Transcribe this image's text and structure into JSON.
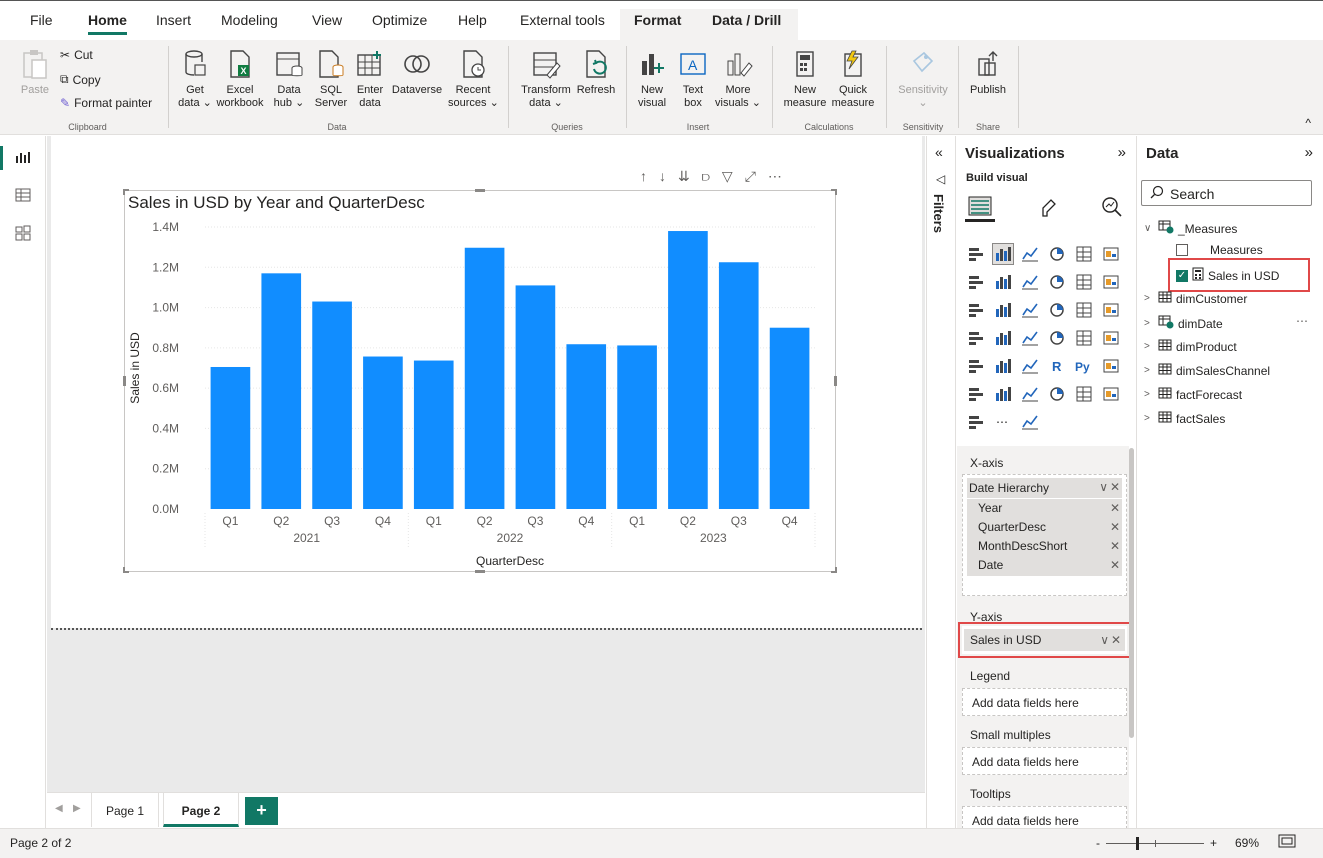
{
  "menu": {
    "tabs": [
      "File",
      "Home",
      "Insert",
      "Modeling",
      "View",
      "Optimize",
      "Help",
      "External tools",
      "Format",
      "Data / Drill"
    ],
    "active": "Home"
  },
  "ribbon": {
    "clipboard": {
      "paste": "Paste",
      "cut": "Cut",
      "copy": "Copy",
      "format_painter": "Format painter",
      "label": "Clipboard"
    },
    "data": {
      "get_data": [
        "Get",
        "data ⌄"
      ],
      "excel": [
        "Excel",
        "workbook"
      ],
      "data_hub": [
        "Data",
        "hub ⌄"
      ],
      "sql": [
        "SQL",
        "Server"
      ],
      "enter": [
        "Enter",
        "data"
      ],
      "dataverse": [
        "Dataverse",
        ""
      ],
      "recent": [
        "Recent",
        "sources ⌄"
      ],
      "label": "Data"
    },
    "queries": {
      "transform": [
        "Transform",
        "data ⌄"
      ],
      "refresh": [
        "Refresh",
        ""
      ],
      "label": "Queries"
    },
    "insert": {
      "new_visual": [
        "New",
        "visual"
      ],
      "text_box": [
        "Text",
        "box"
      ],
      "more_visuals": [
        "More",
        "visuals ⌄"
      ],
      "label": "Insert"
    },
    "calculations": {
      "new_measure": [
        "New",
        "measure"
      ],
      "quick_measure": [
        "Quick",
        "measure"
      ],
      "label": "Calculations"
    },
    "sensitivity": {
      "btn": [
        "Sensitivity",
        "⌄"
      ],
      "label": "Sensitivity"
    },
    "share": {
      "publish": [
        "Publish",
        ""
      ],
      "label": "Share"
    }
  },
  "visual_header_icons": [
    "↑",
    "↓",
    "⇊",
    "⫐",
    "▽",
    "⤢",
    "⋯"
  ],
  "chart_data": {
    "type": "bar",
    "title": "Sales in USD by Year and QuarterDesc",
    "xlabel": "QuarterDesc",
    "ylabel": "Sales in USD",
    "categories": [
      "Q1",
      "Q2",
      "Q3",
      "Q4",
      "Q1",
      "Q2",
      "Q3",
      "Q4",
      "Q1",
      "Q2",
      "Q3",
      "Q4"
    ],
    "groups": [
      {
        "label": "2021",
        "count": 4
      },
      {
        "label": "2022",
        "count": 4
      },
      {
        "label": "2023",
        "count": 4
      }
    ],
    "values": [
      705000,
      1170000,
      1030000,
      757000,
      737000,
      1297000,
      1110000,
      818000,
      812000,
      1380000,
      1225000,
      900000
    ],
    "ylim": [
      0,
      1400000
    ],
    "yticks": [
      "0.0M",
      "0.2M",
      "0.4M",
      "0.6M",
      "0.8M",
      "1.0M",
      "1.2M",
      "1.4M"
    ],
    "color": "#118dff",
    "grid": true
  },
  "filters": {
    "label": "Filters"
  },
  "visualizations": {
    "title": "Visualizations",
    "build_visual": "Build visual",
    "xaxis": {
      "label": "X-axis",
      "hierarchy": "Date Hierarchy",
      "levels": [
        "Year",
        "QuarterDesc",
        "MonthDescShort",
        "Date"
      ]
    },
    "yaxis": {
      "label": "Y-axis",
      "field": "Sales in USD"
    },
    "legend": {
      "label": "Legend",
      "placeholder": "Add data fields here"
    },
    "small_multiples": {
      "label": "Small multiples",
      "placeholder": "Add data fields here"
    },
    "tooltips": {
      "label": "Tooltips",
      "placeholder": "Add data fields here"
    }
  },
  "data_pane": {
    "title": "Data",
    "search_placeholder": "Search",
    "tables": [
      {
        "name": "_Measures",
        "expanded": true
      },
      {
        "name": "dimCustomer"
      },
      {
        "name": "dimDate"
      },
      {
        "name": "dimProduct"
      },
      {
        "name": "dimSalesChannel"
      },
      {
        "name": "factForecast"
      },
      {
        "name": "factSales"
      }
    ],
    "measures": [
      {
        "name": "Measures",
        "checked": false
      },
      {
        "name": "Sales in USD",
        "checked": true
      }
    ]
  },
  "pages": {
    "tabs": [
      "Page 1",
      "Page 2"
    ],
    "active": "Page 2",
    "add": "+"
  },
  "status": {
    "page_info": "Page 2 of 2",
    "zoom": "69%",
    "minus": "-",
    "plus": "+"
  }
}
